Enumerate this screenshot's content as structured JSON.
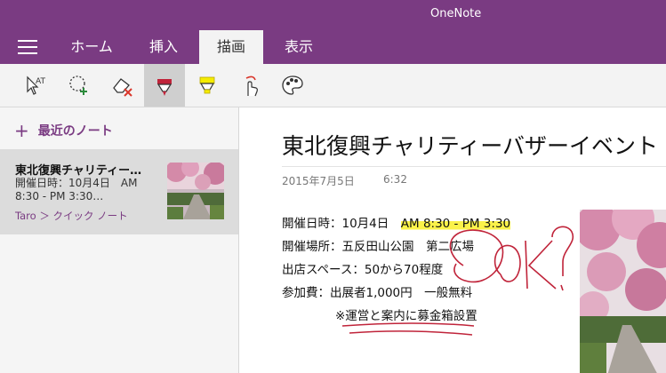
{
  "app": {
    "title": "OneNote"
  },
  "tabs": [
    {
      "label": "ホーム"
    },
    {
      "label": "挿入"
    },
    {
      "label": "描画"
    },
    {
      "label": "表示"
    }
  ],
  "toolbar": {
    "tools": [
      "type-select-icon",
      "lasso-select-icon",
      "eraser-icon",
      "pen-red-icon",
      "highlighter-yellow-icon",
      "ink-to-touch-icon",
      "color-palette-icon"
    ],
    "selected_tool": "pen-red-icon",
    "pen_color": "#c0243a",
    "highlighter_color": "#f5ec00"
  },
  "sidebar": {
    "recent_label": "最近のノート",
    "note": {
      "title": "東北復興チャリティー…",
      "preview_line1": "開催日時：10月4日　AM",
      "preview_line2": "8:30 - PM 3:30…",
      "path": "Taro ＞ クイック ノート"
    }
  },
  "page": {
    "title": "東北復興チャリティーバザーイベント",
    "date": "2015年7月5日",
    "time": "6:32",
    "lines": [
      {
        "prefix": "開催日時：10月4日　",
        "highlight": "AM 8:30 - PM 3:30"
      },
      {
        "text": "開催場所：五反田山公園　第二広場"
      },
      {
        "text": "出店スペース：50から70程度"
      },
      {
        "text": "参加費：出展者1,000円　一般無料"
      },
      {
        "text": "※運営と案内に募金箱設置"
      }
    ],
    "ink_annotation": "OK?"
  },
  "colors": {
    "accent": "#7a3b82",
    "ink": "#c0243a",
    "highlight": "#fbf24a"
  }
}
